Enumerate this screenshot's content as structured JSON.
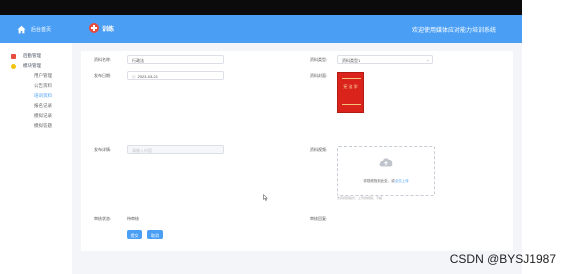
{
  "sidebar": {
    "title": "后台首页",
    "items": [
      {
        "label": "后勤管理",
        "color": "#e74c3c"
      },
      {
        "label": "模块管理",
        "color": "#f1c40f"
      }
    ],
    "subitems": [
      {
        "label": "用户管理",
        "active": false
      },
      {
        "label": "公告资料",
        "active": false
      },
      {
        "label": "培训资料",
        "active": true
      },
      {
        "label": "报名记录",
        "active": false
      },
      {
        "label": "模拟记录",
        "active": false
      },
      {
        "label": "模拟答题",
        "active": false
      }
    ]
  },
  "header": {
    "brand": "训练",
    "welcome": "欢迎使用媒体应对能力培训系统"
  },
  "form": {
    "name_label": "资料名称:",
    "name_value": "行政法",
    "type_label": "资料类型:",
    "type_value": "资料类型1",
    "date_label": "发布日期:",
    "date_value": "2023-03-21",
    "cover_label": "资料封面:",
    "book_title": "宪 法 学",
    "detail_label": "发布详情:",
    "detail_placeholder": "请输入内容",
    "video_label": "资料视频:",
    "upload_text": "将视频拖到此处，或",
    "upload_link": "点击上传",
    "upload_tip": "支持视频格式：上传的视频，不超",
    "status_label": "审核状态:",
    "status_value": "待审核",
    "reply_label": "审核回复:",
    "save_button": "提交",
    "cancel_button": "取消"
  },
  "watermark": "CSDN @BYSJ1987"
}
